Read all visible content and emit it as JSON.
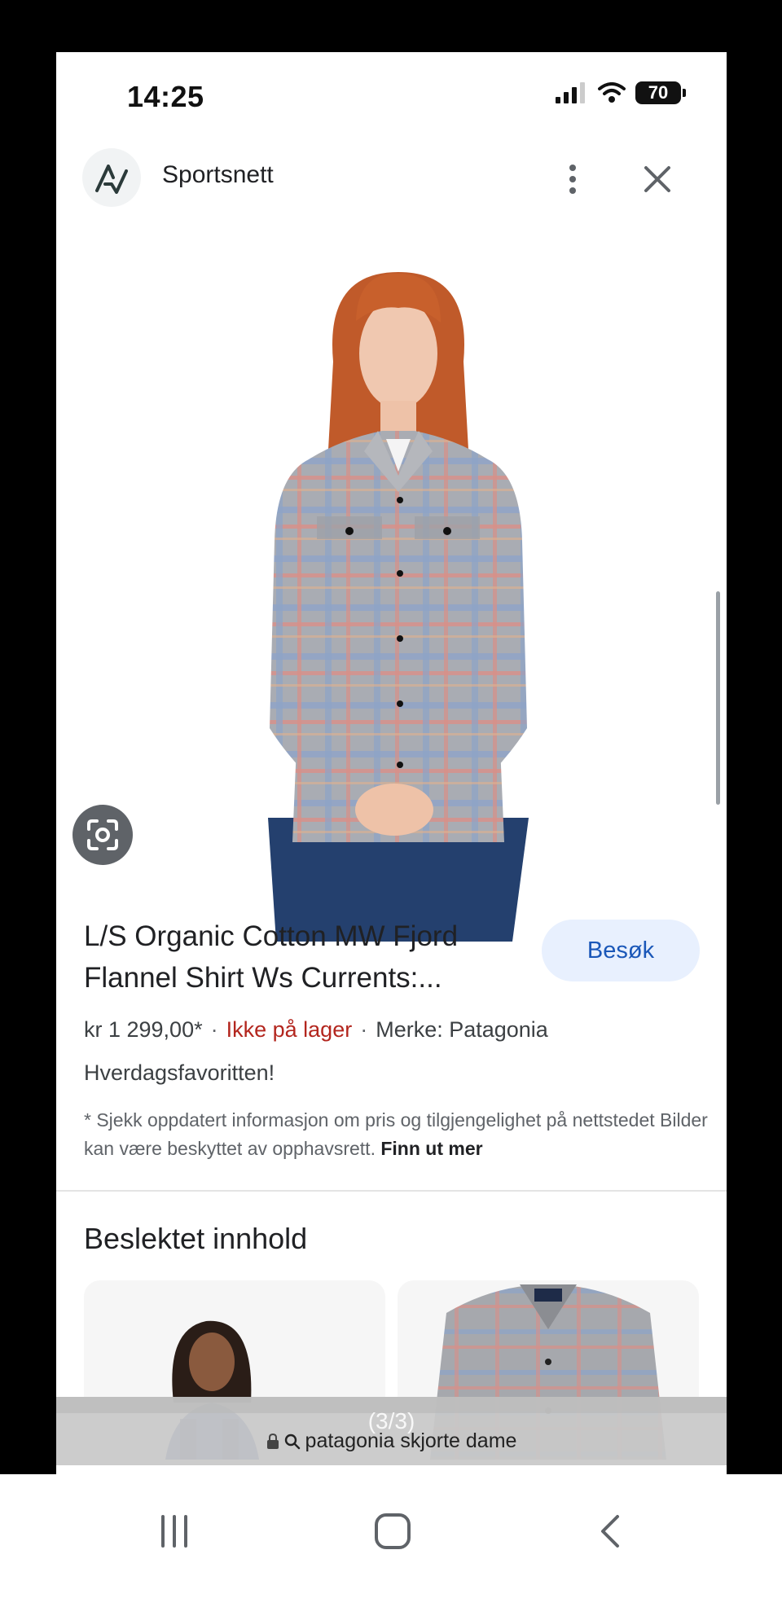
{
  "status_bar": {
    "time": "14:25",
    "battery": "70"
  },
  "header": {
    "site_name": "Sportsnett"
  },
  "product": {
    "title": "L/S Organic Cotton MW Fjord Flannel Shirt Ws Currents:...",
    "visit_label": "Besøk",
    "price": "kr 1 299,00*",
    "stock_status": "Ikke på lager",
    "separator": "·",
    "brand": "Merke: Patagonia",
    "subtitle": "Hverdagsfavoritten!",
    "disclaimer": "* Sjekk oppdatert informasjon om pris og tilgjengelighet på nettstedet Bilder kan være beskyttet av opphavsrett.",
    "disclaimer_link": "Finn ut mer"
  },
  "related": {
    "title": "Beslektet innhold"
  },
  "url_bar": {
    "counter": "(3/3)",
    "query": "patagonia skjorte dame"
  },
  "colors": {
    "accent": "#1a57b8",
    "stock_out": "#b3261e",
    "visit_bg": "#e8f0fe"
  }
}
